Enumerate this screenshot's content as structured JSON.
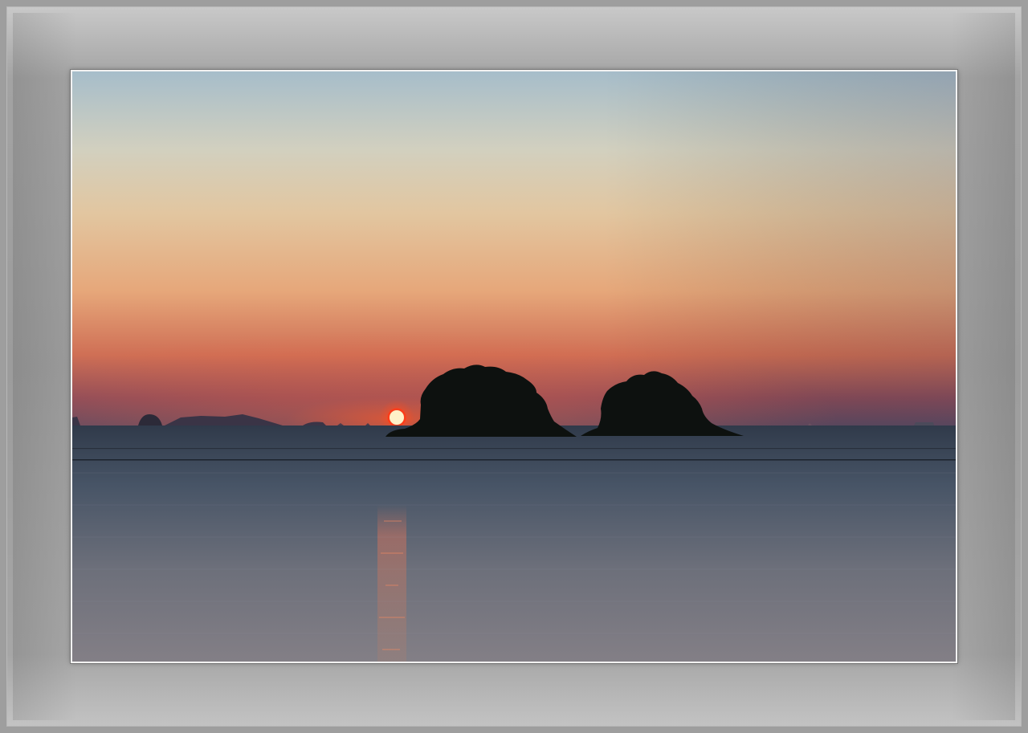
{
  "scene": {
    "subject": "sunset-over-sea",
    "colors": {
      "sky_top": "#a9bfcb",
      "sky_mid": "#e3c9a2",
      "sky_glow": "#e28a5a",
      "horizon_haze": "#7a4c5c",
      "sun": "#fff3c4",
      "sun_halo": "#ff3a1a",
      "sea_far": "#3d4a5a",
      "sea_near": "#7d7f88",
      "island": "#0e1210",
      "frame": "#9c9c9c",
      "mat_border": "#f2f2f2"
    }
  }
}
